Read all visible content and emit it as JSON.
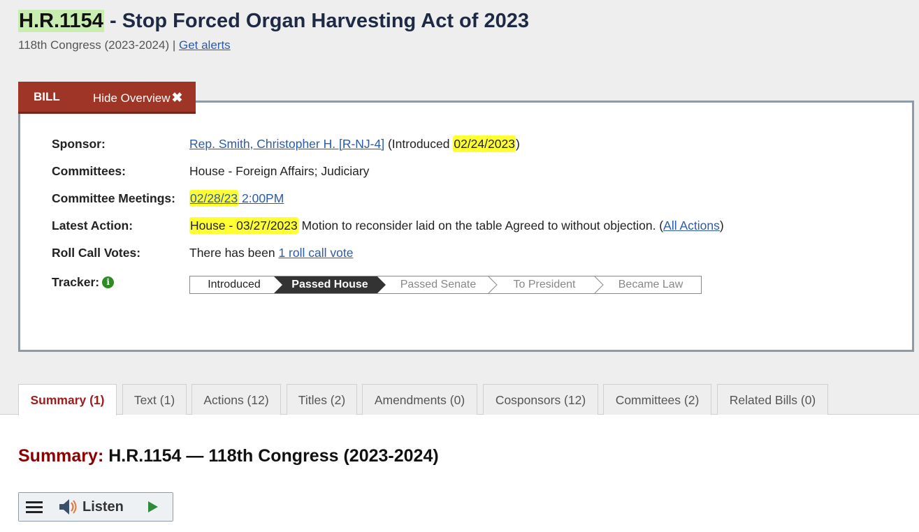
{
  "header": {
    "bill_number": "H.R.1154",
    "bill_name": " - Stop Forced Organ Harvesting Act of 2023",
    "congress": "118th Congress (2023-2024) | ",
    "get_alerts": "Get alerts"
  },
  "overview": {
    "tab_label": "BILL",
    "hide_label": "Hide Overview",
    "sponsor": {
      "label": "Sponsor:",
      "name": "Rep. Smith, Christopher H. [R-NJ-4]",
      "introduced_prefix": " (Introduced ",
      "introduced_date": "02/24/2023",
      "introduced_suffix": ")"
    },
    "committees": {
      "label": "Committees:",
      "value": "House - Foreign Affairs; Judiciary"
    },
    "committee_meetings": {
      "label": "Committee Meetings:",
      "date": "02/28/23",
      "time": " 2:00PM"
    },
    "latest_action": {
      "label": "Latest Action:",
      "highlight": "House - 03/27/2023",
      "text": " Motion to reconsider laid on the table Agreed to without objection.  (",
      "all_actions": "All Actions",
      "close": ")"
    },
    "roll_call": {
      "label": "Roll Call Votes:",
      "prefix": "There has been ",
      "link": "1 roll call vote"
    },
    "tracker": {
      "label": "Tracker:",
      "steps": [
        "Introduced",
        "Passed House",
        "Passed Senate",
        "To President",
        "Became Law"
      ],
      "current_step": "Passed House"
    }
  },
  "tabs": [
    "Summary (1)",
    "Text (1)",
    "Actions (12)",
    "Titles (2)",
    "Amendments (0)",
    "Cosponsors (12)",
    "Committees (2)",
    "Related Bills (0)"
  ],
  "active_tab": "Summary (1)",
  "summary": {
    "label": "Summary:",
    "title": " H.R.1154 — 118th Congress (2023-2024)"
  },
  "player": {
    "listen_label": "Listen",
    "icons": [
      "menu-icon",
      "speaker-icon",
      "play-icon"
    ]
  },
  "colors": {
    "tab_red": "#9e3527",
    "highlight_yellow": "#ffff33",
    "bill_number_green": "#c9ecb0",
    "summary_red": "#8b0000",
    "link_blue": "#2b5ba7"
  }
}
